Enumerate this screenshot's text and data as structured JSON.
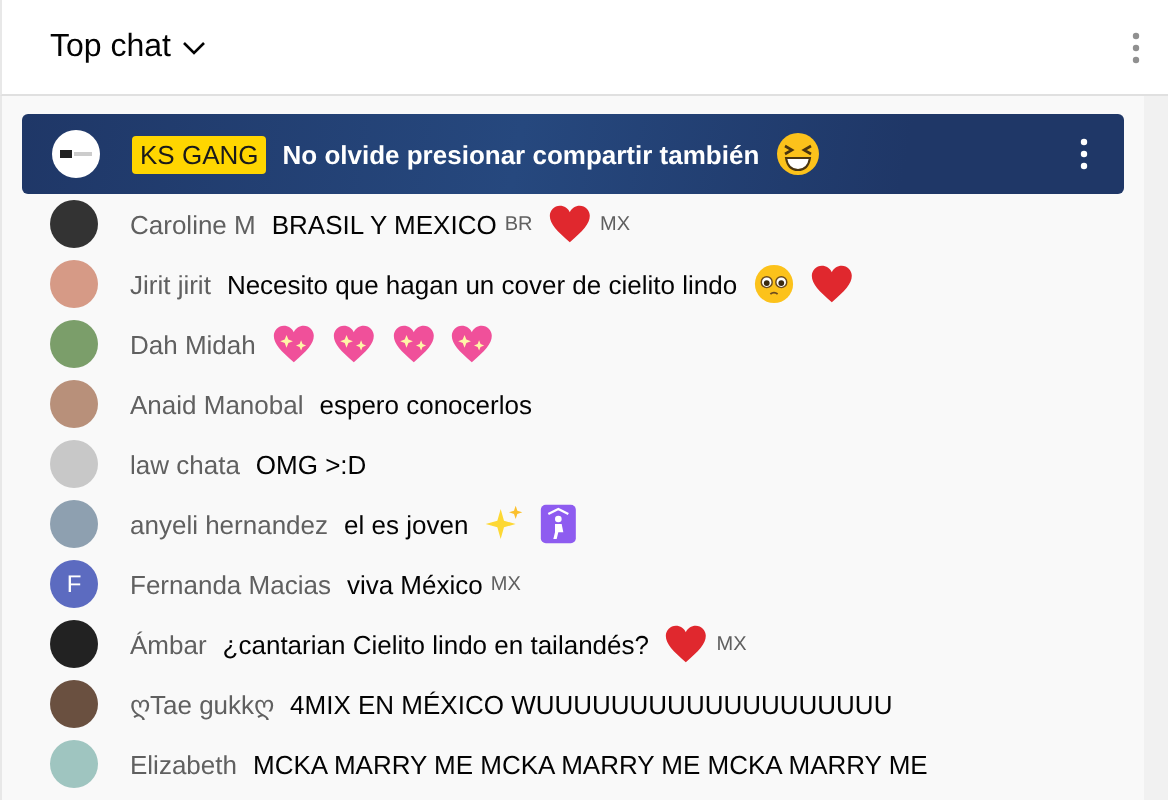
{
  "header": {
    "title": "Top chat"
  },
  "pinned": {
    "badge": "KS GANG",
    "text": "No olvide presionar compartir también"
  },
  "messages": [
    {
      "author": "Caroline M",
      "avatar": {
        "kind": "photo"
      },
      "parts": [
        {
          "kind": "text",
          "text": "BRASIL Y MEXICO"
        },
        {
          "kind": "flag",
          "text": "BR"
        },
        {
          "kind": "heart"
        },
        {
          "kind": "flag",
          "text": "MX"
        }
      ]
    },
    {
      "author": "Jirit jirit",
      "avatar": {
        "kind": "photo"
      },
      "parts": [
        {
          "kind": "text",
          "text": "Necesito que hagan un cover de cielito lindo"
        },
        {
          "kind": "pleading"
        },
        {
          "kind": "heart"
        }
      ]
    },
    {
      "author": "Dah Midah",
      "avatar": {
        "kind": "photo"
      },
      "parts": [
        {
          "kind": "sparkle-heart"
        },
        {
          "kind": "sparkle-heart"
        },
        {
          "kind": "sparkle-heart"
        },
        {
          "kind": "sparkle-heart"
        }
      ]
    },
    {
      "author": "Anaid Manobal",
      "avatar": {
        "kind": "photo"
      },
      "parts": [
        {
          "kind": "text",
          "text": "espero conocerlos"
        }
      ]
    },
    {
      "author": "law chata",
      "avatar": {
        "kind": "photo"
      },
      "parts": [
        {
          "kind": "text",
          "text": "OMG >:D"
        }
      ]
    },
    {
      "author": "anyeli hernandez",
      "avatar": {
        "kind": "photo"
      },
      "parts": [
        {
          "kind": "text",
          "text": "el es joven"
        },
        {
          "kind": "sparkles"
        },
        {
          "kind": "kneel"
        }
      ]
    },
    {
      "author": "Fernanda Macias",
      "avatar": {
        "kind": "letter",
        "letter": "F"
      },
      "parts": [
        {
          "kind": "text",
          "text": "viva México"
        },
        {
          "kind": "flag",
          "text": "MX"
        }
      ]
    },
    {
      "author": "Ámbar",
      "avatar": {
        "kind": "photo"
      },
      "parts": [
        {
          "kind": "text",
          "text": "¿cantarian Cielito lindo en tailandés?"
        },
        {
          "kind": "heart"
        },
        {
          "kind": "flag",
          "text": "MX"
        }
      ]
    },
    {
      "author": "ღTae gukkღ",
      "avatar": {
        "kind": "photo"
      },
      "parts": [
        {
          "kind": "text",
          "text": "4MIX EN MÉXICO WUUUUUUUUUUUUUUUUUUU"
        }
      ]
    },
    {
      "author": "Elizabeth",
      "avatar": {
        "kind": "photo"
      },
      "parts": [
        {
          "kind": "text",
          "text": "MCKA MARRY ME MCKA MARRY ME MCKA MARRY ME"
        }
      ]
    }
  ]
}
